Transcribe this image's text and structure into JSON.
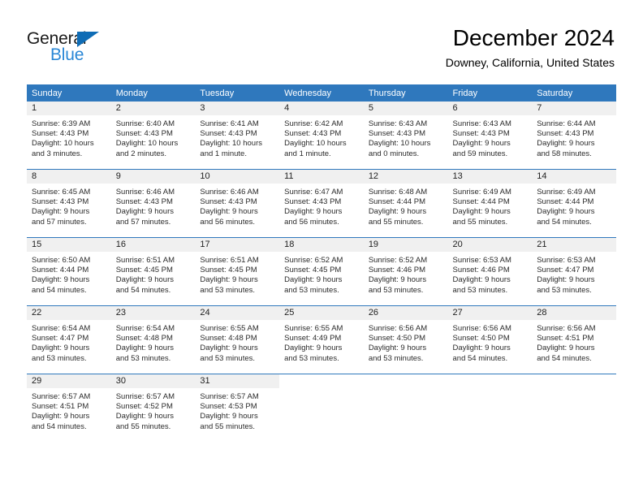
{
  "brand": {
    "name_part1": "General",
    "name_part2": "Blue",
    "triangle_color": "#0f6cb5",
    "blue_text_color": "#2a87d6"
  },
  "header": {
    "month_title": "December 2024",
    "location": "Downey, California, United States"
  },
  "theme": {
    "header_row_bg": "#2f78bd",
    "header_row_text": "#ffffff",
    "daynum_band_bg": "#f0f0f0",
    "grid_line": "#2f78bd",
    "body_text": "#2b2b2b"
  },
  "weekday_headers": [
    "Sunday",
    "Monday",
    "Tuesday",
    "Wednesday",
    "Thursday",
    "Friday",
    "Saturday"
  ],
  "labels": {
    "sunrise_prefix": "Sunrise:",
    "sunset_prefix": "Sunset:",
    "daylight_prefix": "Daylight:"
  },
  "weeks": [
    [
      {
        "day": "1",
        "sunrise": "Sunrise: 6:39 AM",
        "sunset": "Sunset: 4:43 PM",
        "daylight_line1": "Daylight: 10 hours",
        "daylight_line2": "and 3 minutes."
      },
      {
        "day": "2",
        "sunrise": "Sunrise: 6:40 AM",
        "sunset": "Sunset: 4:43 PM",
        "daylight_line1": "Daylight: 10 hours",
        "daylight_line2": "and 2 minutes."
      },
      {
        "day": "3",
        "sunrise": "Sunrise: 6:41 AM",
        "sunset": "Sunset: 4:43 PM",
        "daylight_line1": "Daylight: 10 hours",
        "daylight_line2": "and 1 minute."
      },
      {
        "day": "4",
        "sunrise": "Sunrise: 6:42 AM",
        "sunset": "Sunset: 4:43 PM",
        "daylight_line1": "Daylight: 10 hours",
        "daylight_line2": "and 1 minute."
      },
      {
        "day": "5",
        "sunrise": "Sunrise: 6:43 AM",
        "sunset": "Sunset: 4:43 PM",
        "daylight_line1": "Daylight: 10 hours",
        "daylight_line2": "and 0 minutes."
      },
      {
        "day": "6",
        "sunrise": "Sunrise: 6:43 AM",
        "sunset": "Sunset: 4:43 PM",
        "daylight_line1": "Daylight: 9 hours",
        "daylight_line2": "and 59 minutes."
      },
      {
        "day": "7",
        "sunrise": "Sunrise: 6:44 AM",
        "sunset": "Sunset: 4:43 PM",
        "daylight_line1": "Daylight: 9 hours",
        "daylight_line2": "and 58 minutes."
      }
    ],
    [
      {
        "day": "8",
        "sunrise": "Sunrise: 6:45 AM",
        "sunset": "Sunset: 4:43 PM",
        "daylight_line1": "Daylight: 9 hours",
        "daylight_line2": "and 57 minutes."
      },
      {
        "day": "9",
        "sunrise": "Sunrise: 6:46 AM",
        "sunset": "Sunset: 4:43 PM",
        "daylight_line1": "Daylight: 9 hours",
        "daylight_line2": "and 57 minutes."
      },
      {
        "day": "10",
        "sunrise": "Sunrise: 6:46 AM",
        "sunset": "Sunset: 4:43 PM",
        "daylight_line1": "Daylight: 9 hours",
        "daylight_line2": "and 56 minutes."
      },
      {
        "day": "11",
        "sunrise": "Sunrise: 6:47 AM",
        "sunset": "Sunset: 4:43 PM",
        "daylight_line1": "Daylight: 9 hours",
        "daylight_line2": "and 56 minutes."
      },
      {
        "day": "12",
        "sunrise": "Sunrise: 6:48 AM",
        "sunset": "Sunset: 4:44 PM",
        "daylight_line1": "Daylight: 9 hours",
        "daylight_line2": "and 55 minutes."
      },
      {
        "day": "13",
        "sunrise": "Sunrise: 6:49 AM",
        "sunset": "Sunset: 4:44 PM",
        "daylight_line1": "Daylight: 9 hours",
        "daylight_line2": "and 55 minutes."
      },
      {
        "day": "14",
        "sunrise": "Sunrise: 6:49 AM",
        "sunset": "Sunset: 4:44 PM",
        "daylight_line1": "Daylight: 9 hours",
        "daylight_line2": "and 54 minutes."
      }
    ],
    [
      {
        "day": "15",
        "sunrise": "Sunrise: 6:50 AM",
        "sunset": "Sunset: 4:44 PM",
        "daylight_line1": "Daylight: 9 hours",
        "daylight_line2": "and 54 minutes."
      },
      {
        "day": "16",
        "sunrise": "Sunrise: 6:51 AM",
        "sunset": "Sunset: 4:45 PM",
        "daylight_line1": "Daylight: 9 hours",
        "daylight_line2": "and 54 minutes."
      },
      {
        "day": "17",
        "sunrise": "Sunrise: 6:51 AM",
        "sunset": "Sunset: 4:45 PM",
        "daylight_line1": "Daylight: 9 hours",
        "daylight_line2": "and 53 minutes."
      },
      {
        "day": "18",
        "sunrise": "Sunrise: 6:52 AM",
        "sunset": "Sunset: 4:45 PM",
        "daylight_line1": "Daylight: 9 hours",
        "daylight_line2": "and 53 minutes."
      },
      {
        "day": "19",
        "sunrise": "Sunrise: 6:52 AM",
        "sunset": "Sunset: 4:46 PM",
        "daylight_line1": "Daylight: 9 hours",
        "daylight_line2": "and 53 minutes."
      },
      {
        "day": "20",
        "sunrise": "Sunrise: 6:53 AM",
        "sunset": "Sunset: 4:46 PM",
        "daylight_line1": "Daylight: 9 hours",
        "daylight_line2": "and 53 minutes."
      },
      {
        "day": "21",
        "sunrise": "Sunrise: 6:53 AM",
        "sunset": "Sunset: 4:47 PM",
        "daylight_line1": "Daylight: 9 hours",
        "daylight_line2": "and 53 minutes."
      }
    ],
    [
      {
        "day": "22",
        "sunrise": "Sunrise: 6:54 AM",
        "sunset": "Sunset: 4:47 PM",
        "daylight_line1": "Daylight: 9 hours",
        "daylight_line2": "and 53 minutes."
      },
      {
        "day": "23",
        "sunrise": "Sunrise: 6:54 AM",
        "sunset": "Sunset: 4:48 PM",
        "daylight_line1": "Daylight: 9 hours",
        "daylight_line2": "and 53 minutes."
      },
      {
        "day": "24",
        "sunrise": "Sunrise: 6:55 AM",
        "sunset": "Sunset: 4:48 PM",
        "daylight_line1": "Daylight: 9 hours",
        "daylight_line2": "and 53 minutes."
      },
      {
        "day": "25",
        "sunrise": "Sunrise: 6:55 AM",
        "sunset": "Sunset: 4:49 PM",
        "daylight_line1": "Daylight: 9 hours",
        "daylight_line2": "and 53 minutes."
      },
      {
        "day": "26",
        "sunrise": "Sunrise: 6:56 AM",
        "sunset": "Sunset: 4:50 PM",
        "daylight_line1": "Daylight: 9 hours",
        "daylight_line2": "and 53 minutes."
      },
      {
        "day": "27",
        "sunrise": "Sunrise: 6:56 AM",
        "sunset": "Sunset: 4:50 PM",
        "daylight_line1": "Daylight: 9 hours",
        "daylight_line2": "and 54 minutes."
      },
      {
        "day": "28",
        "sunrise": "Sunrise: 6:56 AM",
        "sunset": "Sunset: 4:51 PM",
        "daylight_line1": "Daylight: 9 hours",
        "daylight_line2": "and 54 minutes."
      }
    ],
    [
      {
        "day": "29",
        "sunrise": "Sunrise: 6:57 AM",
        "sunset": "Sunset: 4:51 PM",
        "daylight_line1": "Daylight: 9 hours",
        "daylight_line2": "and 54 minutes."
      },
      {
        "day": "30",
        "sunrise": "Sunrise: 6:57 AM",
        "sunset": "Sunset: 4:52 PM",
        "daylight_line1": "Daylight: 9 hours",
        "daylight_line2": "and 55 minutes."
      },
      {
        "day": "31",
        "sunrise": "Sunrise: 6:57 AM",
        "sunset": "Sunset: 4:53 PM",
        "daylight_line1": "Daylight: 9 hours",
        "daylight_line2": "and 55 minutes."
      },
      {
        "day": "",
        "sunrise": "",
        "sunset": "",
        "daylight_line1": "",
        "daylight_line2": ""
      },
      {
        "day": "",
        "sunrise": "",
        "sunset": "",
        "daylight_line1": "",
        "daylight_line2": ""
      },
      {
        "day": "",
        "sunrise": "",
        "sunset": "",
        "daylight_line1": "",
        "daylight_line2": ""
      },
      {
        "day": "",
        "sunrise": "",
        "sunset": "",
        "daylight_line1": "",
        "daylight_line2": ""
      }
    ]
  ]
}
